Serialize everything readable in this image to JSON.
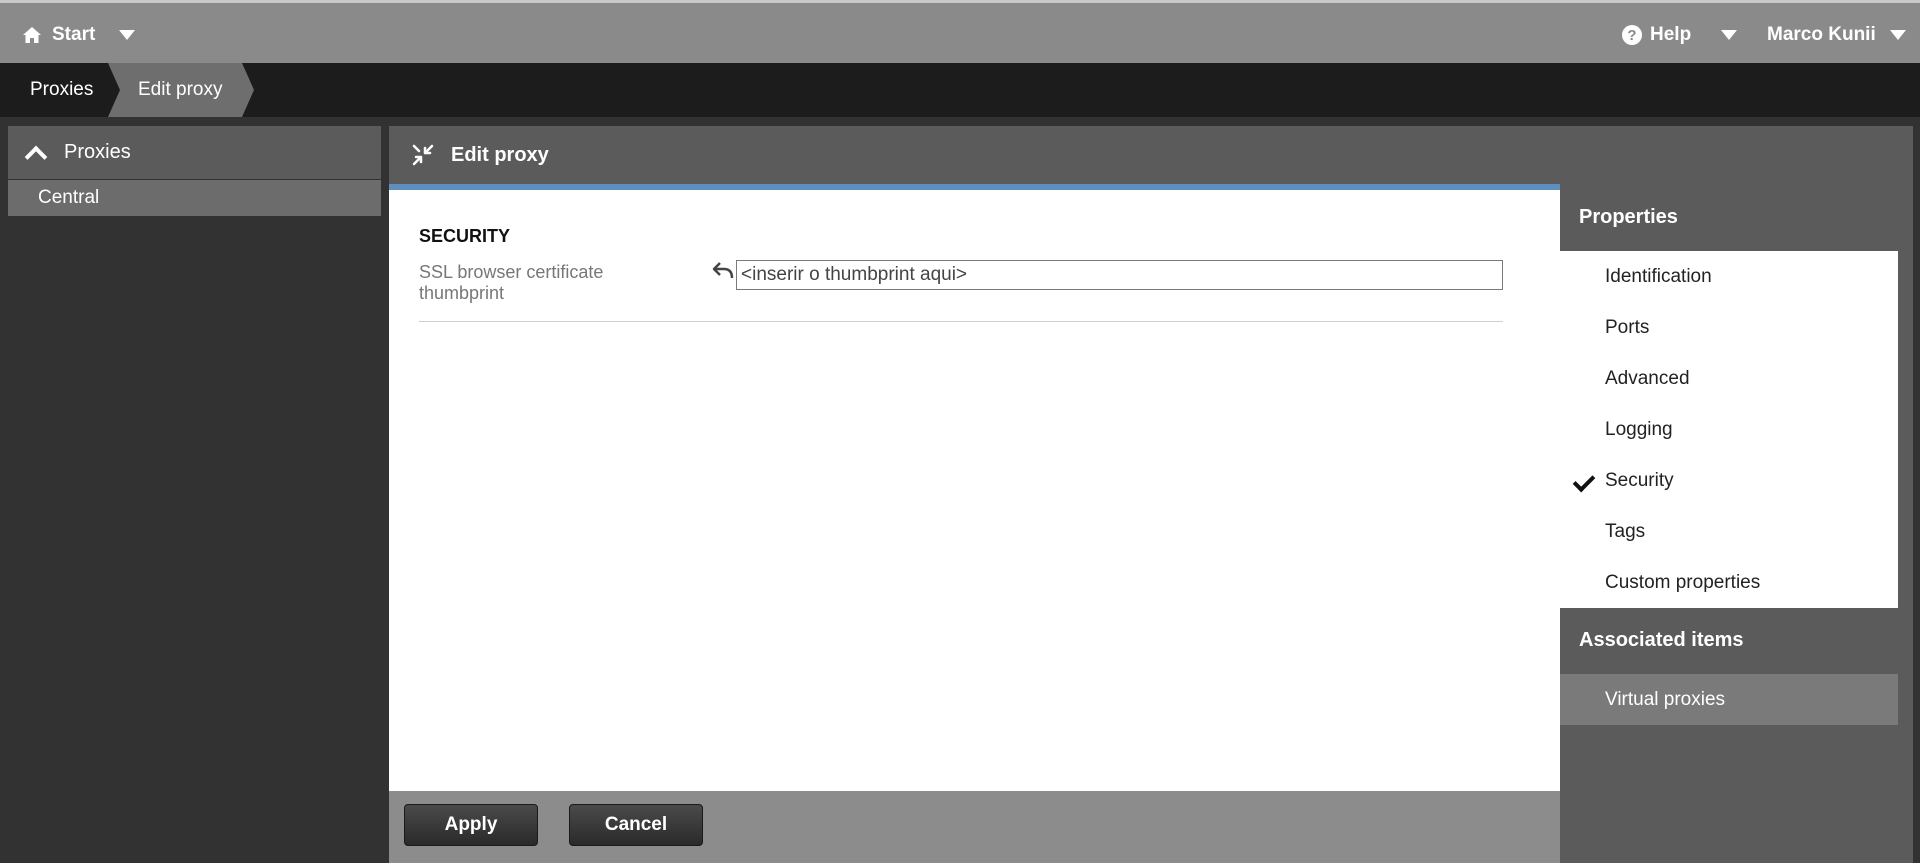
{
  "topbar": {
    "start_label": "Start",
    "start_icon": "home-icon",
    "help_label": "Help",
    "help_icon": "question-circle-icon",
    "user_name": "Marco Kunii"
  },
  "breadcrumb": {
    "items": [
      {
        "label": "Proxies"
      },
      {
        "label": "Edit proxy"
      }
    ]
  },
  "leftnav": {
    "section_label": "Proxies",
    "items": [
      {
        "label": "Central",
        "selected": true
      }
    ]
  },
  "main": {
    "header_title": "Edit proxy",
    "header_icon": "collapse-arrows-icon",
    "section_title": "SECURITY",
    "field": {
      "label": "SSL browser certificate thumbprint",
      "value": "<inserir o thumbprint aqui>"
    },
    "apply_label": "Apply",
    "cancel_label": "Cancel"
  },
  "properties": {
    "heading": "Properties",
    "items": [
      {
        "label": "Identification",
        "checked": false
      },
      {
        "label": "Ports",
        "checked": false
      },
      {
        "label": "Advanced",
        "checked": false
      },
      {
        "label": "Logging",
        "checked": false
      },
      {
        "label": "Security",
        "checked": true
      },
      {
        "label": "Tags",
        "checked": false
      },
      {
        "label": "Custom properties",
        "checked": false
      }
    ]
  },
  "associated": {
    "heading": "Associated items",
    "items": [
      {
        "label": "Virtual proxies"
      }
    ]
  },
  "colors": {
    "topbar_bg": "#8a8a8a",
    "crumbbar_bg": "#1c1c1c",
    "panel_bg": "#5b5b5b",
    "accent_blue": "#5f8fbf"
  }
}
